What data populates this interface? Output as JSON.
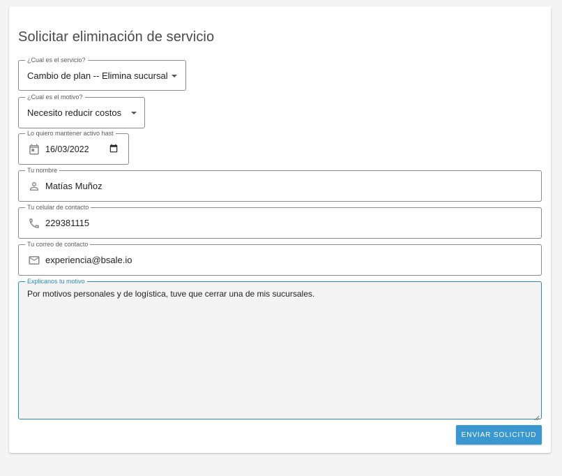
{
  "form": {
    "title": "Solicitar eliminación de servicio",
    "service": {
      "label": "¿Cual es el servicio?",
      "value": "Cambio de plan -- Elimina sucursal"
    },
    "reason": {
      "label": "¿Cual es el motivo?",
      "value": "Necesito reducir costos"
    },
    "keep_active_until": {
      "label": "Lo quiero mantener activo hast",
      "value": "16/03/2022"
    },
    "name": {
      "label": "Tu nombre",
      "value": "Matías Muñoz"
    },
    "phone": {
      "label": "Tu celular de contacto",
      "value": "229381115"
    },
    "email": {
      "label": "Tu correo de contacto",
      "value": "experiencia@bsale.io"
    },
    "explanation": {
      "label": "Explicanos tu motivo",
      "value": "Por motivos personales y de logística, tuve que cerrar una de mis sucursales."
    },
    "submit_label": "ENVIAR SOLICITUD"
  },
  "icons": {
    "date": "calendar-icon",
    "name": "person-icon",
    "phone": "phone-icon",
    "email": "mail-icon",
    "dropdown": "caret-down-icon"
  },
  "colors": {
    "accent": "#3b97cf",
    "focus_border": "#2a8ab8",
    "page_background": "#f4f4f4"
  }
}
